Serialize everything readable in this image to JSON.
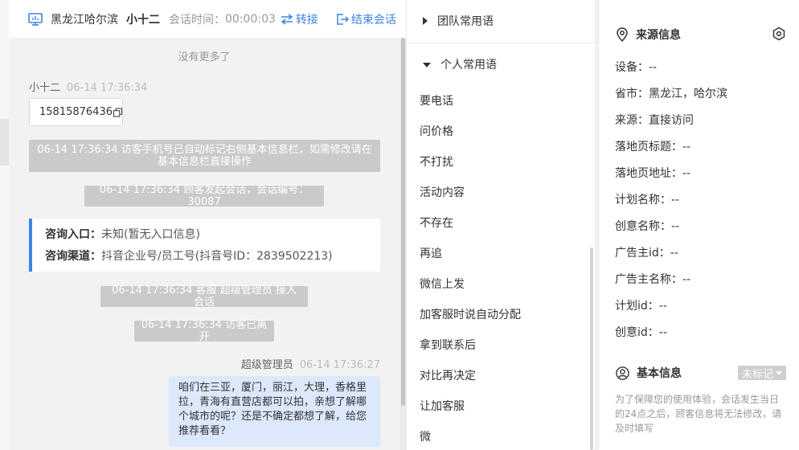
{
  "header": {
    "location": "黑龙江哈尔滨",
    "visitor_name": "小十二",
    "session_time_label": "会话时间：",
    "session_time_value": "00:00:03",
    "transfer_label": "转接",
    "end_label": "结束会话"
  },
  "chat": {
    "no_more": "没有更多了",
    "visitor_msg": {
      "sender": "小十二",
      "time": "06-14 17:36:34",
      "text": "15815876436"
    },
    "system_notes": [
      "06-14 17:36:34 访客手机号已自动标记右侧基本信息栏，如需修改请在基本信息栏直接操作",
      "06-14 17:36:34 顾客发起会话，会话编号：30087",
      "06-14 17:36:34 客服 超级管理员 接入会话",
      "06-14 17:36:34 访客已离开"
    ],
    "inquiry": {
      "entry_label": "咨询入口：",
      "entry_value": "未知(暂无入口信息)",
      "channel_label": "咨询渠道：",
      "channel_value": "抖音企业号/员工号(抖音号ID：2839502213)"
    },
    "agent_msg": {
      "sender": "超级管理员",
      "time": "06-14 17:36:27",
      "text": "咱们在三亚，厦门，丽江，大理，香格里拉，青海有直营店都可以拍，亲想了解哪个城市的呢？还是不确定都想了解，给您推荐看看？"
    }
  },
  "phrases": {
    "team_group": "团队常用语",
    "personal_group": "个人常用语",
    "items": [
      "要电话",
      "问价格",
      "不打扰",
      "活动内容",
      "不存在",
      "再追",
      "微信上发",
      "加客服时说自动分配",
      "拿到联系后",
      "对比再决定",
      "让加客服",
      "微"
    ]
  },
  "info": {
    "source": {
      "title": "来源信息",
      "rows": [
        "设备：--",
        "省市：黑龙江，哈尔滨",
        "来源：直接访问",
        "落地页标题：--",
        "落地页地址：--",
        "计划名称：--",
        "创意名称：--",
        "广告主id：--",
        "广告主名称：--",
        "计划id：--",
        "创意id：--"
      ]
    },
    "basic": {
      "title": "基本信息",
      "tag_label": "未标记",
      "notice": "为了保障您的使用体验，会话发生当日的24点之后，顾客信息将无法修改，请及时填写"
    }
  },
  "colors": {
    "accent": "#3b84e8",
    "system_note_bg": "#cacaca",
    "agent_bubble_bg": "#dce8fb"
  },
  "icons": [
    "monitor-icon",
    "transfer-icon",
    "exit-icon",
    "copy-icon",
    "location-pin-icon",
    "target-icon",
    "user-circle-icon"
  ]
}
